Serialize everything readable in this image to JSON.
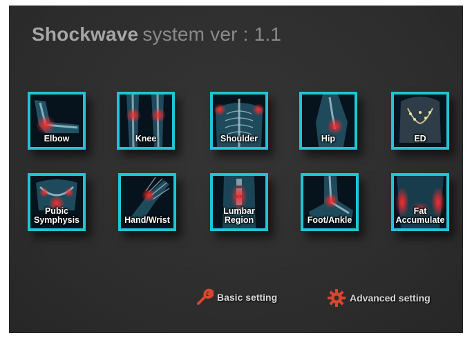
{
  "header": {
    "brand": "Shockwave",
    "subtitle": "system ver : 1.1"
  },
  "colors": {
    "tile_border": "#1fc5d6",
    "background": "#2f2f2f",
    "highlight": "#d8252f",
    "setting_icon": "#d9462f"
  },
  "tiles": [
    {
      "label": "Elbow",
      "icon": "elbow-icon"
    },
    {
      "label": "Knee",
      "icon": "knee-icon"
    },
    {
      "label": "Shoulder",
      "icon": "shoulder-icon"
    },
    {
      "label": "Hip",
      "icon": "hip-icon"
    },
    {
      "label": "ED",
      "icon": "ed-icon"
    },
    {
      "label": "Pubic\nSymphysis",
      "icon": "pubic-symphysis-icon"
    },
    {
      "label": "Hand/Wrist",
      "icon": "hand-wrist-icon"
    },
    {
      "label": "Lumbar\nRegion",
      "icon": "lumbar-region-icon"
    },
    {
      "label": "Foot/Ankle",
      "icon": "foot-ankle-icon"
    },
    {
      "label": "Fat\nAccumulate",
      "icon": "fat-accumulate-icon"
    }
  ],
  "settings": {
    "basic_label": "Basic setting",
    "basic_icon": "wrench-icon",
    "advanced_label": "Advanced setting",
    "advanced_icon": "gear-icon"
  }
}
